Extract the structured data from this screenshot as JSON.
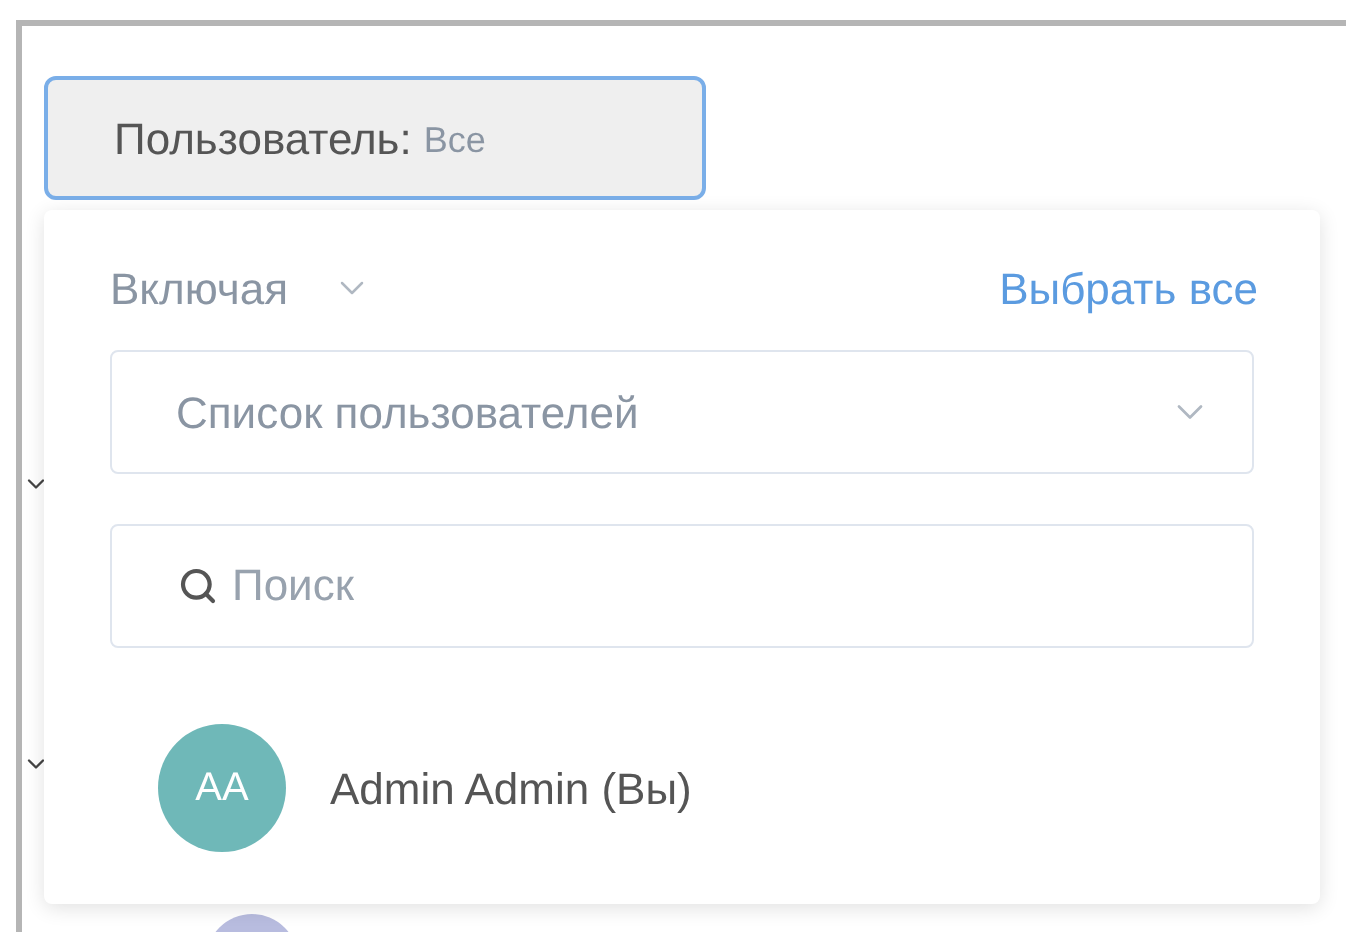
{
  "filter_button": {
    "label": "Пользователь:",
    "value": "Все",
    "focused": true
  },
  "dropdown": {
    "mode": "Включая",
    "select_all": "Выбрать все",
    "user_list_select": {
      "placeholder": "Список пользователей"
    },
    "search": {
      "placeholder": "Поиск"
    },
    "users": [
      {
        "initials": "AA",
        "name": "Admin Admin (Вы)",
        "color": "#6fb8b8"
      }
    ]
  }
}
